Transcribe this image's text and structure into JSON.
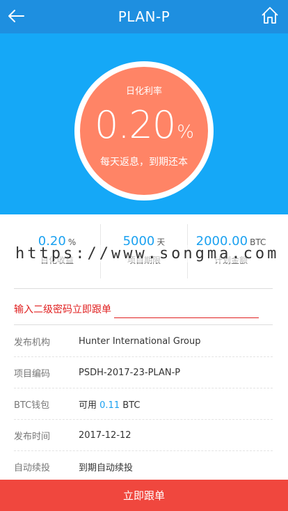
{
  "header": {
    "title": "PLAN-P",
    "back_icon": "back-arrow-icon",
    "home_icon": "home-icon"
  },
  "hero": {
    "label": "日化利率",
    "rate_value": "0.20",
    "rate_unit": "%",
    "note": "每天返息，到期还本"
  },
  "stats": [
    {
      "value": "0.20",
      "unit": "%",
      "label": "日化收益"
    },
    {
      "value": "5000",
      "unit": "天",
      "label": "项目期限"
    },
    {
      "value": "2000.00",
      "unit": "BTC",
      "label": "计划金额"
    }
  ],
  "watermark": "https://www.songma.com",
  "password": {
    "label": "输入二级密码立即跟单",
    "value": ""
  },
  "info": {
    "publisher_key": "发布机构",
    "publisher_val": "Hunter International Group",
    "code_key": "项目编码",
    "code_val": "PSDH-2017-23-PLAN-P",
    "wallet_key": "BTC钱包",
    "wallet_prefix": "可用",
    "wallet_amount": "0.11",
    "wallet_unit": "BTC",
    "date_key": "发布时间",
    "date_val": "2017-12-12",
    "renew_key": "自动续投",
    "renew_val": "到期自动续投"
  },
  "footer": {
    "button_label": "立即跟单"
  },
  "colors": {
    "header": "#1e8fe0",
    "hero": "#15a8f7",
    "circle": "#ff8466",
    "accent": "#1ba1f0",
    "button": "#f0473e",
    "warning": "#e02020"
  }
}
